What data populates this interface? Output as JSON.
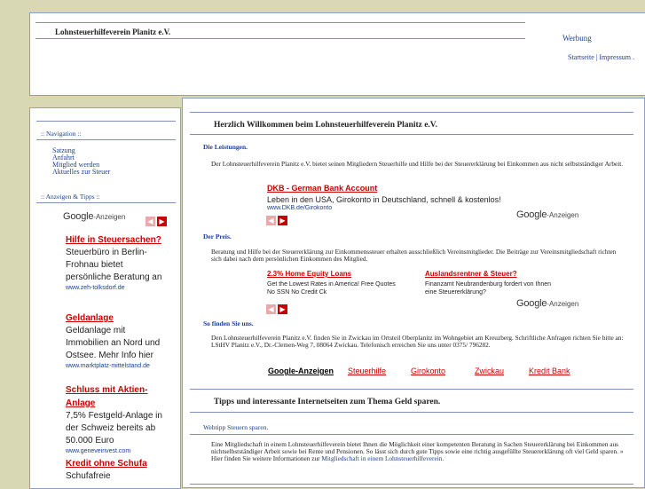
{
  "header": {
    "site_title": "Lohnsteuerhilfeverein Planitz e.V.",
    "werbung": "Werbung",
    "nav": [
      {
        "label": "Startseite"
      },
      {
        "label": "Impressum"
      }
    ],
    "nav_sep": "|",
    "nav_tail": "."
  },
  "sidebar": {
    "navigation_heading": ":: Navigation ::",
    "nav_items": [
      {
        "label": "Satzung"
      },
      {
        "label": "Anfahrt"
      },
      {
        "label": "Mitglied werden"
      },
      {
        "label": "Aktuelles zur Steuer"
      }
    ],
    "ads_heading": ":: Anzeigen & Tipps ::",
    "google_word": "Google",
    "anzeigen": "-Anzeigen",
    "ads": [
      {
        "title": "Hilfe in Steuersachen?",
        "desc": "Steuerbüro in Berlin-Frohnau bietet persönliche Beratung an",
        "url": "www.zeh-tolksdorf.de"
      },
      {
        "title": "Geldanlage",
        "desc": "Geldanlage mit Immobilien an Nord und Ostsee. Mehr Info hier",
        "url": "www.marktplatz-mittelstand.de"
      },
      {
        "title": "Schluss mit Aktien-Anlage",
        "desc": "7,5% Festgeld-Anlage in der Schweiz bereits ab 50.000 Euro",
        "url": "www.geneveinvest.com"
      },
      {
        "title": "Kredit ohne Schufa",
        "desc": "Schufafreie"
      }
    ]
  },
  "main": {
    "welcome": "Herzlich Willkommen beim Lohnsteuerhilfeverein Planitz e.V.",
    "s1_heading": "Die Leistungen.",
    "s1_text": "Der Lohnsteuerhilfeverein Planitz e.V. bietet seinen Mitgliedern Steuerhilfe und Hilfe bei der Steuererklärung bei Einkommen aus nicht selbstständiger Arbeit.",
    "ad1": {
      "title": "DKB - German Bank Account",
      "desc": "Leben in den USA, Girokonto in Deutschland, schnell & kostenlos!",
      "url": "www.DKB.de/Girokonto"
    },
    "google_word": "Google",
    "anzeigen": "-Anzeigen",
    "s2_heading": "Der Preis.",
    "s2_text": "Beratung und Hilfe bei der Steuererklärung zur Einkommenssteuer erhalten ausschließlich Vereinsmitglieder. Die Beiträge zur Vereinsmitgliedschaft richten sich dabei nach dem persönlichen Einkommen des Mitglied.",
    "ad2a": {
      "title": "2.3% Home Equity Loans",
      "desc1": "Get the Lowest Rates in America! Free Quotes",
      "desc2": "No SSN No Credit Ck"
    },
    "ad2b": {
      "title": "Auslandsrentner & Steuer?",
      "desc1": "Finanzamt Neubrandenburg fordert von Ihnen",
      "desc2": "eine Steuererklärung?"
    },
    "s3_heading": "So finden Sie uns.",
    "s3_text": "Den Lohnsteuerhilfeverein Planitz e.V. finden Sie in Zwickau im Ortsteil Oberplanitz im Wohngebiet am Kreuzberg. Schriftliche Anfragen richten Sie bitte an: LStHV Planitz e.V., Dr.-Clemen-Weg 7, 08064 Zwickau. Telefonisch erreichen Sie uns unter 0375/ 796282.",
    "linkbar": [
      {
        "label": "Google-Anzeigen"
      },
      {
        "label": "Steuerhilfe"
      },
      {
        "label": "Girokonto"
      },
      {
        "label": "Zwickau"
      },
      {
        "label": "Kredit Bank"
      }
    ],
    "tips_heading": "Tipps und interessante Internetseiten zum Thema Geld sparen.",
    "webtipp": "Webtipp Steuern sparen.",
    "tips_text": "Eine Mitgliedschaft in einem Lohnsteuerhilfeverein bietet Ihnen die Möglichkeit einer kompetenten Beratung in Sachen Steuererklärung bei Einkommen aus nichtselbstständiger Arbeit sowie bei Rente und Pensionen. So lässt sich durch gute Tipps sowie eine richtig ausgefüllte Steuererklärung oft viel Geld sparen.",
    "tips_link_prefix": "» Hier finden Sie weitere Informationen zur",
    "tips_link": "Mitgliedschaft in einem Lohnsteuerhilfeverein."
  }
}
